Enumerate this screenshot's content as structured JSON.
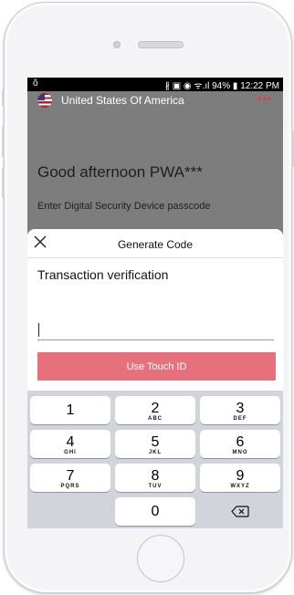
{
  "status_bar": {
    "left": "ô",
    "right": "∦ ▣ ◉ ᯤ.ıl 94% ▮ 12:22 PM"
  },
  "header": {
    "country": "United States Of America",
    "menu_icon": "more-dots-icon",
    "menu_label": "•••",
    "accent_color": "#e53b3b"
  },
  "greeting": "Good afternoon PWA***",
  "instruction": "Enter Digital Security Device passcode",
  "sheet": {
    "close_icon": "close-icon",
    "title": "Generate Code",
    "label": "Transaction verification",
    "input_value": "",
    "button_label": "Use Touch ID",
    "button_color": "#e6707c"
  },
  "keypad": {
    "keys": [
      {
        "num": "1",
        "letters": ""
      },
      {
        "num": "2",
        "letters": "ABC"
      },
      {
        "num": "3",
        "letters": "DEF"
      },
      {
        "num": "4",
        "letters": "GHI"
      },
      {
        "num": "5",
        "letters": "JKL"
      },
      {
        "num": "6",
        "letters": "MNO"
      },
      {
        "num": "7",
        "letters": "PQRS"
      },
      {
        "num": "8",
        "letters": "TUV"
      },
      {
        "num": "9",
        "letters": "WXYZ"
      },
      {
        "num": "0",
        "letters": ""
      }
    ],
    "delete_icon": "backspace-icon"
  }
}
